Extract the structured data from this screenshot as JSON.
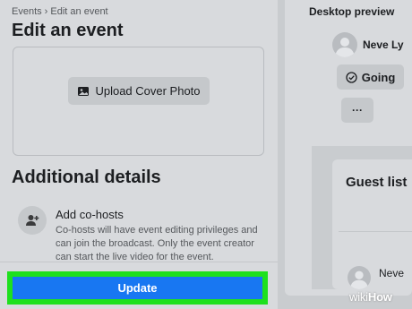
{
  "editor": {
    "breadcrumb": "Events › Edit an event",
    "title": "Edit an event",
    "upload_cover_label": "Upload Cover Photo",
    "additional_details_title": "Additional details",
    "cohosts_title": "Add co-hosts",
    "cohosts_description": "Co-hosts will have event editing privileges and can join the broadcast. Only the event creator can start the live video for the event.",
    "update_label": "Update",
    "highlight_color": "#1ee01e",
    "accent_color": "#1877f2"
  },
  "preview": {
    "label": "Desktop preview",
    "host_name": "Neve Ly",
    "going_label": "Going",
    "more_label": "···",
    "guest_list_title": "Guest list",
    "guest_name": "Neve"
  },
  "watermark": {
    "wiki": "wiki",
    "how": "How"
  },
  "icons": [
    "image-icon",
    "user-plus-icon",
    "check-circle-icon",
    "avatar-icon"
  ]
}
